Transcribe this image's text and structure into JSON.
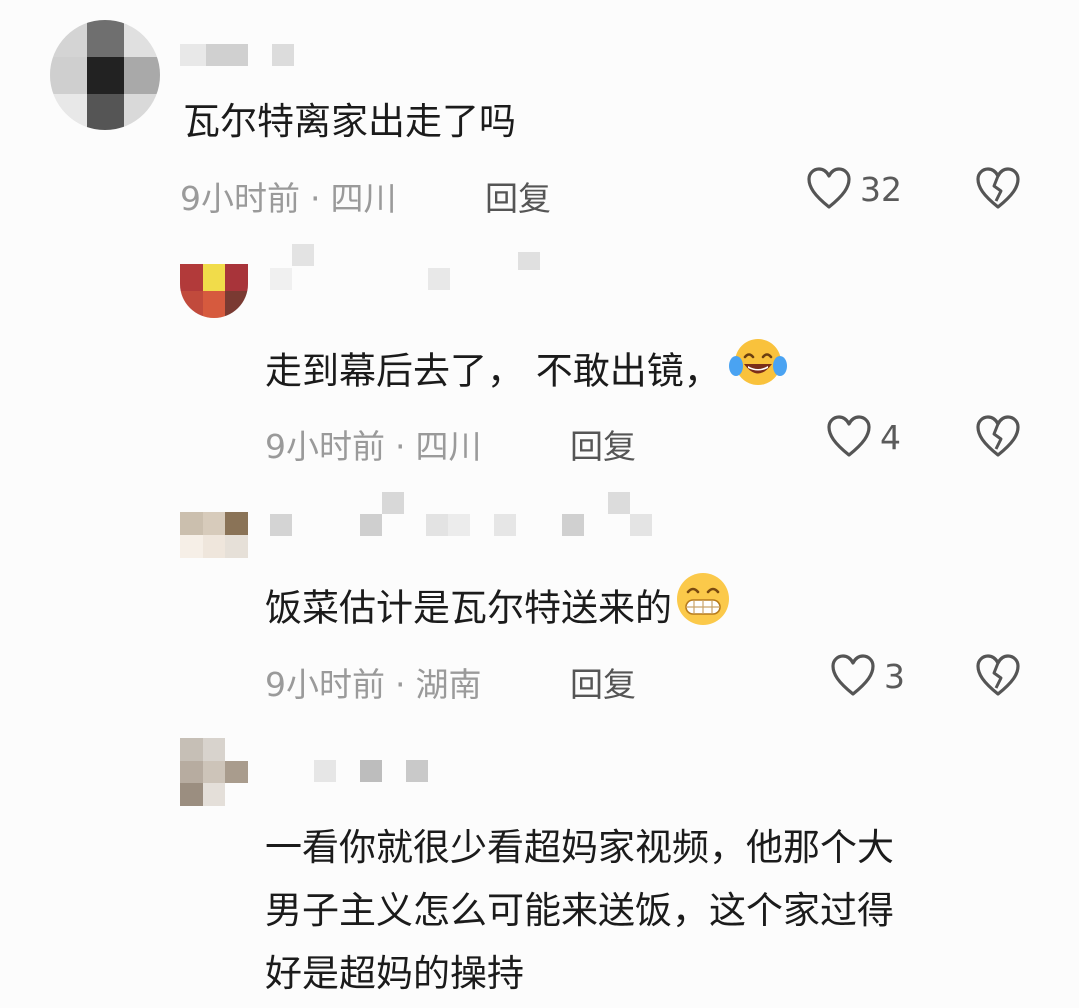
{
  "comments": [
    {
      "text": "瓦尔特离家出走了吗",
      "time": "9小时前",
      "separator": "·",
      "location": "四川",
      "reply_label": "回复",
      "likes": "32",
      "level": "top"
    },
    {
      "text": "走到幕后去了，  不敢出镜，",
      "emoji": "laughing-tears-emoji",
      "time": "9小时前",
      "separator": "·",
      "location": "四川",
      "reply_label": "回复",
      "likes": "4",
      "level": "reply"
    },
    {
      "text": "饭菜估计是瓦尔特送来的",
      "emoji": "grinning-teeth-emoji",
      "time": "9小时前",
      "separator": "·",
      "location": "湖南",
      "reply_label": "回复",
      "likes": "3",
      "level": "reply"
    },
    {
      "lines": [
        "一看你就很少看超妈家视频，他那个大",
        "男子主义怎么可能来送饭，这个家过得",
        "好是超妈的操持"
      ],
      "level": "reply"
    }
  ],
  "icons": {
    "like": "heart-outline-icon",
    "dislike": "broken-heart-icon"
  },
  "colors": {
    "text": "#1b1b1b",
    "meta": "#9a9a9a",
    "icon": "#555555"
  }
}
